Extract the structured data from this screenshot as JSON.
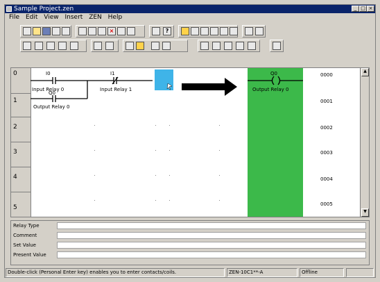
{
  "window": {
    "title": "Sample Project.zen",
    "controls": [
      "_",
      "□",
      "×"
    ]
  },
  "menu": [
    "File",
    "Edit",
    "View",
    "Insert",
    "ZEN",
    "Help"
  ],
  "toolbar1": {
    "icons": [
      "new-file-icon",
      "open-icon",
      "save-icon",
      "print-icon",
      "print-preview-icon",
      "cut-icon",
      "copy-icon",
      "paste-icon",
      "delete-icon",
      "undo-icon",
      "redo-icon",
      "find-icon",
      "help-icon",
      "monitor-icon",
      "transfer-icon",
      "read-icon",
      "write-icon",
      "compare-icon",
      "connect-icon",
      "disconnect-icon"
    ]
  },
  "toolbar2": {
    "icons": [
      "select-icon",
      "contact-no-icon",
      "contact-nc-icon",
      "horizontal-line-icon",
      "vertical-line-icon",
      "zoom-icon",
      "find-contact-icon",
      "coil-icon",
      "function-block-icon",
      "edit-icon",
      "element-icon",
      "register-icon",
      "table-icon",
      "insert-row-icon",
      "delete-row-icon",
      "program-icon"
    ]
  },
  "ladder": {
    "rows": [
      "0",
      "1",
      "2",
      "3",
      "4",
      "5"
    ],
    "addresses": [
      "0000",
      "0001",
      "0002",
      "0003",
      "0004",
      "0005"
    ],
    "contacts": [
      {
        "address": "I0",
        "name": "Input Relay 0"
      },
      {
        "address": "I1",
        "name": "Input Relay 1"
      },
      {
        "address": "Q0",
        "name": "Output Relay 0"
      }
    ],
    "coil": {
      "address": "Q0",
      "name": "Output Relay 0"
    },
    "colors": {
      "coil_highlight": "#3cb94a",
      "cursor": "#3fb4e8"
    }
  },
  "info": {
    "labels": [
      "Relay Type",
      "Comment",
      "Set Value",
      "Present Value"
    ]
  },
  "status": {
    "hint": "Double-click (Personal Enter key) enables you to enter contacts/coils.",
    "model": "ZEN-10C1**-A",
    "mode": "Offline"
  }
}
